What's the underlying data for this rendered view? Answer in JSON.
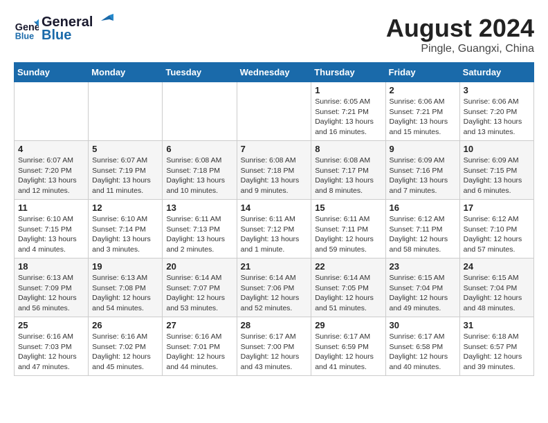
{
  "header": {
    "logo_line1": "General",
    "logo_line2": "Blue",
    "month_year": "August 2024",
    "location": "Pingle, Guangxi, China"
  },
  "weekdays": [
    "Sunday",
    "Monday",
    "Tuesday",
    "Wednesday",
    "Thursday",
    "Friday",
    "Saturday"
  ],
  "weeks": [
    [
      {
        "day": "",
        "info": ""
      },
      {
        "day": "",
        "info": ""
      },
      {
        "day": "",
        "info": ""
      },
      {
        "day": "",
        "info": ""
      },
      {
        "day": "1",
        "info": "Sunrise: 6:05 AM\nSunset: 7:21 PM\nDaylight: 13 hours\nand 16 minutes."
      },
      {
        "day": "2",
        "info": "Sunrise: 6:06 AM\nSunset: 7:21 PM\nDaylight: 13 hours\nand 15 minutes."
      },
      {
        "day": "3",
        "info": "Sunrise: 6:06 AM\nSunset: 7:20 PM\nDaylight: 13 hours\nand 13 minutes."
      }
    ],
    [
      {
        "day": "4",
        "info": "Sunrise: 6:07 AM\nSunset: 7:20 PM\nDaylight: 13 hours\nand 12 minutes."
      },
      {
        "day": "5",
        "info": "Sunrise: 6:07 AM\nSunset: 7:19 PM\nDaylight: 13 hours\nand 11 minutes."
      },
      {
        "day": "6",
        "info": "Sunrise: 6:08 AM\nSunset: 7:18 PM\nDaylight: 13 hours\nand 10 minutes."
      },
      {
        "day": "7",
        "info": "Sunrise: 6:08 AM\nSunset: 7:18 PM\nDaylight: 13 hours\nand 9 minutes."
      },
      {
        "day": "8",
        "info": "Sunrise: 6:08 AM\nSunset: 7:17 PM\nDaylight: 13 hours\nand 8 minutes."
      },
      {
        "day": "9",
        "info": "Sunrise: 6:09 AM\nSunset: 7:16 PM\nDaylight: 13 hours\nand 7 minutes."
      },
      {
        "day": "10",
        "info": "Sunrise: 6:09 AM\nSunset: 7:15 PM\nDaylight: 13 hours\nand 6 minutes."
      }
    ],
    [
      {
        "day": "11",
        "info": "Sunrise: 6:10 AM\nSunset: 7:15 PM\nDaylight: 13 hours\nand 4 minutes."
      },
      {
        "day": "12",
        "info": "Sunrise: 6:10 AM\nSunset: 7:14 PM\nDaylight: 13 hours\nand 3 minutes."
      },
      {
        "day": "13",
        "info": "Sunrise: 6:11 AM\nSunset: 7:13 PM\nDaylight: 13 hours\nand 2 minutes."
      },
      {
        "day": "14",
        "info": "Sunrise: 6:11 AM\nSunset: 7:12 PM\nDaylight: 13 hours\nand 1 minute."
      },
      {
        "day": "15",
        "info": "Sunrise: 6:11 AM\nSunset: 7:11 PM\nDaylight: 12 hours\nand 59 minutes."
      },
      {
        "day": "16",
        "info": "Sunrise: 6:12 AM\nSunset: 7:11 PM\nDaylight: 12 hours\nand 58 minutes."
      },
      {
        "day": "17",
        "info": "Sunrise: 6:12 AM\nSunset: 7:10 PM\nDaylight: 12 hours\nand 57 minutes."
      }
    ],
    [
      {
        "day": "18",
        "info": "Sunrise: 6:13 AM\nSunset: 7:09 PM\nDaylight: 12 hours\nand 56 minutes."
      },
      {
        "day": "19",
        "info": "Sunrise: 6:13 AM\nSunset: 7:08 PM\nDaylight: 12 hours\nand 54 minutes."
      },
      {
        "day": "20",
        "info": "Sunrise: 6:14 AM\nSunset: 7:07 PM\nDaylight: 12 hours\nand 53 minutes."
      },
      {
        "day": "21",
        "info": "Sunrise: 6:14 AM\nSunset: 7:06 PM\nDaylight: 12 hours\nand 52 minutes."
      },
      {
        "day": "22",
        "info": "Sunrise: 6:14 AM\nSunset: 7:05 PM\nDaylight: 12 hours\nand 51 minutes."
      },
      {
        "day": "23",
        "info": "Sunrise: 6:15 AM\nSunset: 7:04 PM\nDaylight: 12 hours\nand 49 minutes."
      },
      {
        "day": "24",
        "info": "Sunrise: 6:15 AM\nSunset: 7:04 PM\nDaylight: 12 hours\nand 48 minutes."
      }
    ],
    [
      {
        "day": "25",
        "info": "Sunrise: 6:16 AM\nSunset: 7:03 PM\nDaylight: 12 hours\nand 47 minutes."
      },
      {
        "day": "26",
        "info": "Sunrise: 6:16 AM\nSunset: 7:02 PM\nDaylight: 12 hours\nand 45 minutes."
      },
      {
        "day": "27",
        "info": "Sunrise: 6:16 AM\nSunset: 7:01 PM\nDaylight: 12 hours\nand 44 minutes."
      },
      {
        "day": "28",
        "info": "Sunrise: 6:17 AM\nSunset: 7:00 PM\nDaylight: 12 hours\nand 43 minutes."
      },
      {
        "day": "29",
        "info": "Sunrise: 6:17 AM\nSunset: 6:59 PM\nDaylight: 12 hours\nand 41 minutes."
      },
      {
        "day": "30",
        "info": "Sunrise: 6:17 AM\nSunset: 6:58 PM\nDaylight: 12 hours\nand 40 minutes."
      },
      {
        "day": "31",
        "info": "Sunrise: 6:18 AM\nSunset: 6:57 PM\nDaylight: 12 hours\nand 39 minutes."
      }
    ]
  ]
}
